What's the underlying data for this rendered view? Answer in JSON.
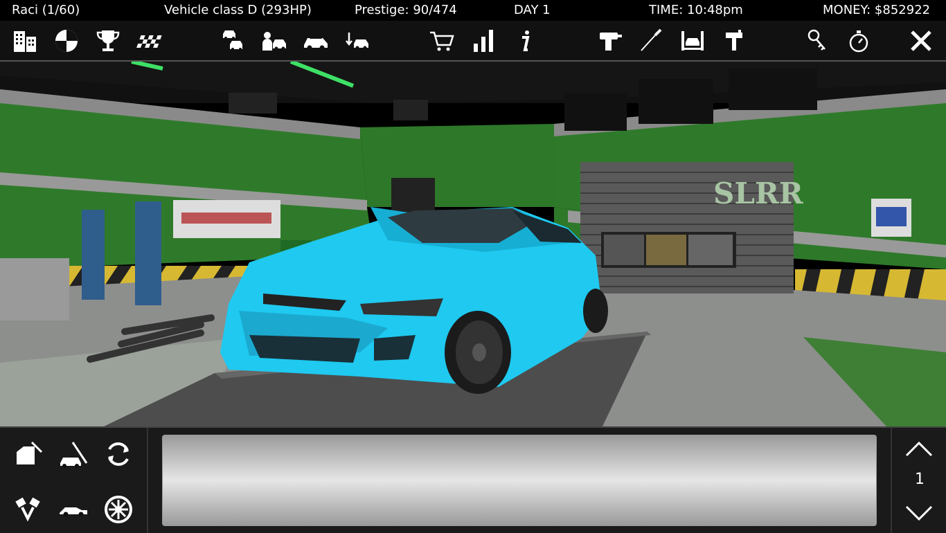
{
  "status": {
    "player": "Raci (1/60)",
    "vehicle_class": "Vehicle class D (293HP)",
    "prestige": "Prestige: 90/474",
    "day": "DAY 1",
    "time": "TIME: 10:48pm",
    "money": "MONEY: $852922"
  },
  "toolbar": {
    "icons": [
      "city-icon",
      "race-flag-circle-icon",
      "trophy-icon",
      "checkered-flag-icon",
      "car-dealer-icon",
      "car-sell-icon",
      "car-crash-icon",
      "car-swap-icon",
      "shop-cart-icon",
      "stats-bars-icon",
      "info-icon",
      "drill-icon",
      "screwdriver-icon",
      "car-lift-icon",
      "paint-gun-icon",
      "key-icon",
      "stopwatch-icon",
      "close-icon"
    ]
  },
  "scene": {
    "sign_text": "SLRR",
    "car_color": "#1fc9f0"
  },
  "bottom": {
    "tools": [
      "car-door-wrench-icon",
      "car-wrench-icon",
      "refresh-icon",
      "pistons-icon",
      "car-profile-icon",
      "wheel-icon"
    ],
    "page_number": "1"
  },
  "colors": {
    "wall_green": "#2f7a2a",
    "bar_bg": "#111111"
  }
}
